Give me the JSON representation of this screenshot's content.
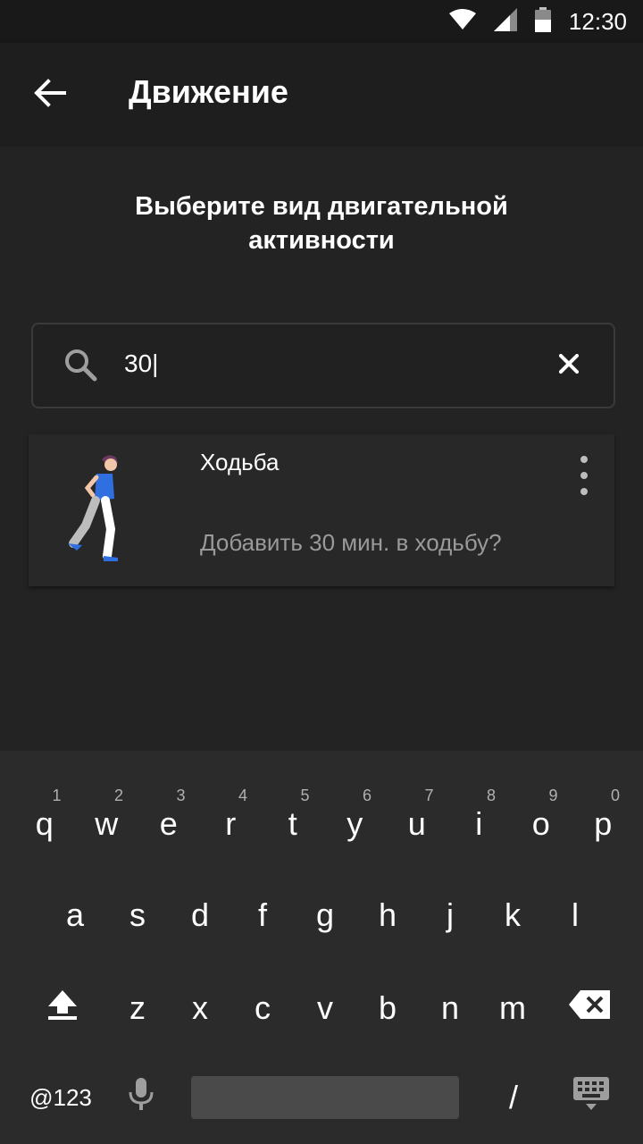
{
  "status_bar": {
    "time": "12:30",
    "icons": [
      "wifi-icon",
      "signal-icon",
      "battery-icon"
    ]
  },
  "app_bar": {
    "title": "Движение",
    "back_icon": "arrow-left-icon"
  },
  "prompt": {
    "line1": "Выберите вид двигательной",
    "line2": "активности"
  },
  "search": {
    "value": "30|",
    "search_icon": "search-icon",
    "clear_icon": "close-icon"
  },
  "results": [
    {
      "title": "Ходьба",
      "subtitle": "Добавить 30 мин. в ходьбу?",
      "image": "walking-person-illustration",
      "menu_icon": "more-vert-icon"
    }
  ],
  "keyboard": {
    "row1": [
      {
        "key": "q",
        "hint": "1"
      },
      {
        "key": "w",
        "hint": "2"
      },
      {
        "key": "e",
        "hint": "3"
      },
      {
        "key": "r",
        "hint": "4"
      },
      {
        "key": "t",
        "hint": "5"
      },
      {
        "key": "y",
        "hint": "6"
      },
      {
        "key": "u",
        "hint": "7"
      },
      {
        "key": "i",
        "hint": "8"
      },
      {
        "key": "o",
        "hint": "9"
      },
      {
        "key": "p",
        "hint": "0"
      }
    ],
    "row2": [
      "a",
      "s",
      "d",
      "f",
      "g",
      "h",
      "j",
      "k",
      "l"
    ],
    "row3": [
      "z",
      "x",
      "c",
      "v",
      "b",
      "n",
      "m"
    ],
    "symbols_label": "@123",
    "slash_label": "/",
    "shift_icon": "shift-icon",
    "backspace_icon": "backspace-icon",
    "mic_icon": "microphone-icon",
    "hide_keyboard_icon": "keyboard-hide-icon"
  },
  "colors": {
    "background": "#212121",
    "app_bar": "#1e1e1e",
    "card": "#282828",
    "keyboard": "#2b2b2b",
    "accent_blue": "#2f6fe0"
  }
}
